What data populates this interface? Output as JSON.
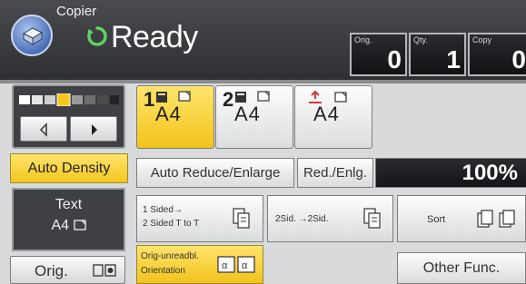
{
  "header": {
    "app_label": "Copier",
    "status": "Ready",
    "counters": {
      "orig": {
        "label": "Orig.",
        "value": "0"
      },
      "qty": {
        "label": "Qty.",
        "value": "1"
      },
      "copy": {
        "label": "Copy",
        "value": "0"
      }
    }
  },
  "left_panel": {
    "auto_density_label": "Auto Density",
    "original_type": {
      "line1": "Text",
      "line2": "A4"
    },
    "orig_button_label": "Orig."
  },
  "trays": [
    {
      "number": "1",
      "size": "A4",
      "selected": true
    },
    {
      "number": "2",
      "size": "A4",
      "selected": false
    },
    {
      "number": "",
      "size": "A4",
      "selected": false
    }
  ],
  "reduce_enlarge": {
    "auto_label": "Auto Reduce/Enlarge",
    "red_enlg_label": "Red./Enlg.",
    "ratio": "100%"
  },
  "functions": {
    "duplex": {
      "line1": "1 Sided→",
      "line2": "2 Sided T to T"
    },
    "combine": {
      "label": "2Sid. →2Sid."
    },
    "sort": {
      "label": "Sort"
    },
    "orientation": {
      "line1": "Orig-unreadbl.",
      "line2": "Orientation"
    },
    "other_func_label": "Other Func."
  },
  "colors": {
    "selected_yellow": "#f4c61e",
    "header_dark": "#2e2f33",
    "status_green": "#5fd35f",
    "panel_gray": "#d9dadb"
  }
}
